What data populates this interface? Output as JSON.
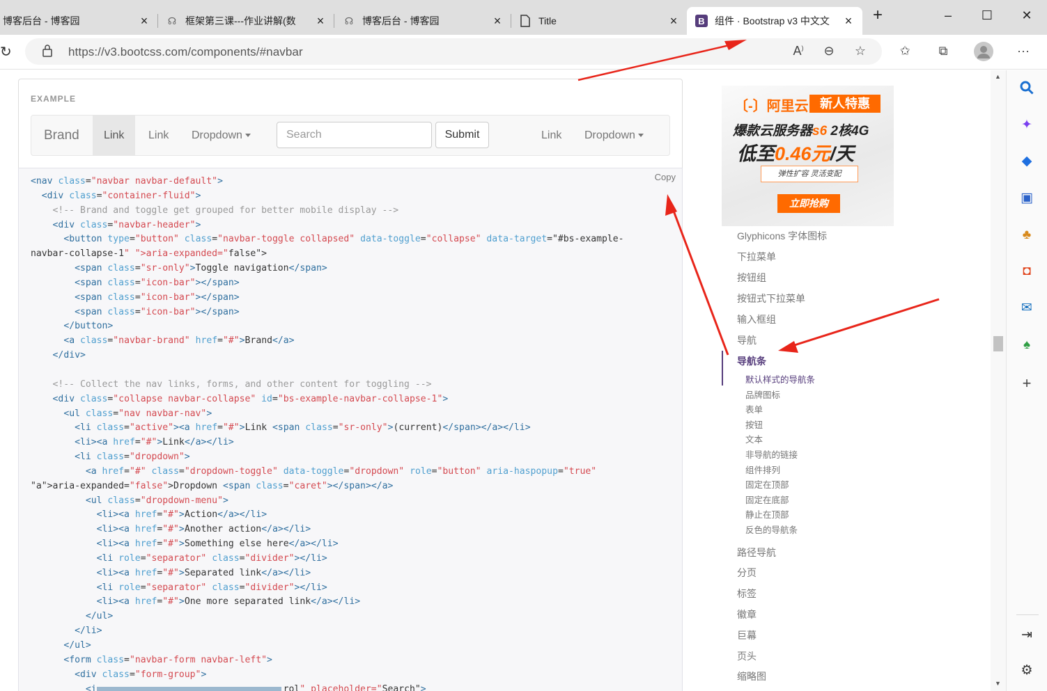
{
  "browser": {
    "tabs": [
      {
        "label": "博客后台 - 博客园",
        "icon": "blog-icon"
      },
      {
        "label": "框架第三课---作业讲解(数",
        "icon": "blog-icon"
      },
      {
        "label": "博客后台 - 博客园",
        "icon": "blog-icon"
      },
      {
        "label": "Title",
        "icon": "page-icon"
      },
      {
        "label": "组件 · Bootstrap v3 中文文",
        "icon": "bootstrap-icon",
        "icon_text": "B",
        "active": true
      }
    ],
    "url": "https://v3.bootcss.com/components/#navbar"
  },
  "example": {
    "label": "EXAMPLE",
    "brand": "Brand",
    "link_active": "Link",
    "link": "Link",
    "dropdown": "Dropdown",
    "search_placeholder": "Search",
    "submit": "Submit",
    "right_link": "Link",
    "right_dropdown": "Dropdown"
  },
  "code": {
    "copy_label": "Copy",
    "lines": [
      "<nav class=\"navbar navbar-default\">",
      "  <div class=\"container-fluid\">",
      "    <!-- Brand and toggle get grouped for better mobile display -->",
      "    <div class=\"navbar-header\">",
      "      <button type=\"button\" class=\"navbar-toggle collapsed\" data-toggle=\"collapse\" data-target=\"#bs-example-",
      "navbar-collapse-1\" aria-expanded=\"false\">",
      "        <span class=\"sr-only\">Toggle navigation</span>",
      "        <span class=\"icon-bar\"></span>",
      "        <span class=\"icon-bar\"></span>",
      "        <span class=\"icon-bar\"></span>",
      "      </button>",
      "      <a class=\"navbar-brand\" href=\"#\">Brand</a>",
      "    </div>",
      "",
      "    <!-- Collect the nav links, forms, and other content for toggling -->",
      "    <div class=\"collapse navbar-collapse\" id=\"bs-example-navbar-collapse-1\">",
      "      <ul class=\"nav navbar-nav\">",
      "        <li class=\"active\"><a href=\"#\">Link <span class=\"sr-only\">(current)</span></a></li>",
      "        <li><a href=\"#\">Link</a></li>",
      "        <li class=\"dropdown\">",
      "          <a href=\"#\" class=\"dropdown-toggle\" data-toggle=\"dropdown\" role=\"button\" aria-haspopup=\"true\"",
      "aria-expanded=\"false\">Dropdown <span class=\"caret\"></span></a>",
      "          <ul class=\"dropdown-menu\">",
      "            <li><a href=\"#\">Action</a></li>",
      "            <li><a href=\"#\">Another action</a></li>",
      "            <li><a href=\"#\">Something else here</a></li>",
      "            <li role=\"separator\" class=\"divider\"></li>",
      "            <li><a href=\"#\">Separated link</a></li>",
      "            <li role=\"separator\" class=\"divider\"></li>",
      "            <li><a href=\"#\">One more separated link</a></li>",
      "          </ul>",
      "        </li>",
      "      </ul>",
      "      <form class=\"navbar-form navbar-left\">",
      "        <div class=\"form-group\">",
      "          <i                                  rol\" placeholder=\"Search\">"
    ]
  },
  "ad": {
    "logo": "〔-〕阿里云",
    "badge": "新人特惠",
    "line1_a": "爆款云服务器",
    "line1_b": "s6",
    "line1_c": " 2核4G",
    "line2_a": "低至",
    "line2_b": "0.46元",
    "line2_c": "/天",
    "tag": "弹性扩容 灵活变配",
    "button": "立即抢购"
  },
  "sidebar": {
    "items_before": [
      "Glyphicons 字体图标",
      "下拉菜单",
      "按钮组",
      "按钮式下拉菜单",
      "输入框组",
      "导航"
    ],
    "active": "导航条",
    "subitems": [
      "默认样式的导航条",
      "品牌图标",
      "表单",
      "按钮",
      "文本",
      "非导航的链接",
      "组件排列",
      "固定在顶部",
      "固定在底部",
      "静止在顶部",
      "反色的导航条"
    ],
    "items_after": [
      "路径导航",
      "分页",
      "标签",
      "徽章",
      "巨幕",
      "页头",
      "缩略图"
    ]
  },
  "colors": {
    "accent_purple": "#563d7c",
    "arrow_red": "#e8251a",
    "ad_orange": "#ff6a00"
  }
}
